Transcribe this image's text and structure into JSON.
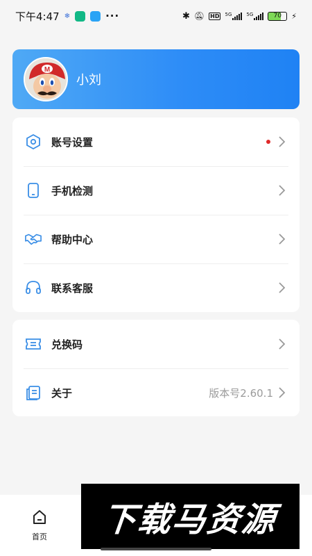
{
  "status_bar": {
    "time": "下午4:47",
    "network_label": "5G",
    "battery_level": "70",
    "icons": [
      "bluetooth-icon",
      "mute-icon",
      "hd-icon",
      "signal-icon",
      "battery-icon",
      "charging-icon"
    ]
  },
  "profile": {
    "username": "小刘",
    "avatar": "mario-avatar"
  },
  "menu_group_1": [
    {
      "label": "账号设置",
      "icon": "hexagon-settings-icon",
      "has_badge": true
    },
    {
      "label": "手机检测",
      "icon": "phone-icon",
      "has_badge": false
    },
    {
      "label": "帮助中心",
      "icon": "handshake-icon",
      "has_badge": false
    },
    {
      "label": "联系客服",
      "icon": "headset-icon",
      "has_badge": false
    }
  ],
  "menu_group_2": [
    {
      "label": "兑换码",
      "icon": "ticket-icon",
      "value": ""
    },
    {
      "label": "关于",
      "icon": "document-icon",
      "value": "版本号2.60.1"
    }
  ],
  "bottom_nav": {
    "home_label": "首页"
  },
  "watermark": {
    "text": "下载马资源"
  },
  "colors": {
    "accent": "#2d8cf7",
    "icon_blue": "#3a8ee6",
    "badge_red": "#e02a2a"
  }
}
